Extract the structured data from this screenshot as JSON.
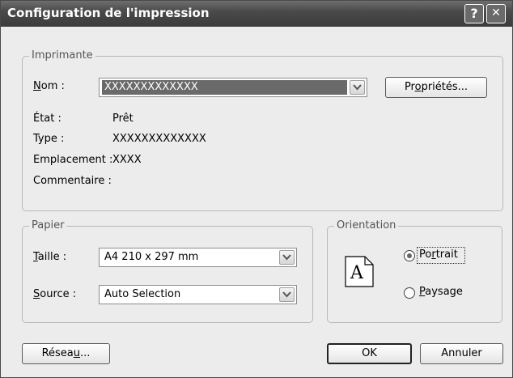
{
  "window": {
    "title": "Configuration de l'impression",
    "help_glyph": "?",
    "close_glyph": "✕"
  },
  "printer": {
    "legend": "Imprimante",
    "name_label_u": "N",
    "name_label_rest": "om :",
    "name_value": "XXXXXXXXXXXXX",
    "properties_pre": "Pr",
    "properties_u": "o",
    "properties_post": "priétés...",
    "state_label": "État :",
    "state_value": "Prêt",
    "type_label": "Type :",
    "type_value": "XXXXXXXXXXXXX",
    "location_label": "Emplacement :",
    "location_value": "XXXX",
    "comment_label": "Commentaire :",
    "comment_value": ""
  },
  "paper": {
    "legend": "Papier",
    "size_label_u": "T",
    "size_label_rest": "aille :",
    "size_value": "A4 210 x 297 mm",
    "source_label_u": "S",
    "source_label_rest": "ource :",
    "source_value": "Auto Selection"
  },
  "orientation": {
    "legend": "Orientation",
    "page_glyph": "A",
    "portrait_pre": "Po",
    "portrait_u": "r",
    "portrait_post": "trait",
    "landscape_u": "P",
    "landscape_post": "aysage",
    "selected": "portrait"
  },
  "footer": {
    "network_pre": "Résea",
    "network_u": "u",
    "network_post": "...",
    "ok_label": "OK",
    "cancel_label": "Annuler"
  },
  "icons": {
    "dropdown": "chevron-down-icon",
    "page": "page-portrait-icon"
  }
}
